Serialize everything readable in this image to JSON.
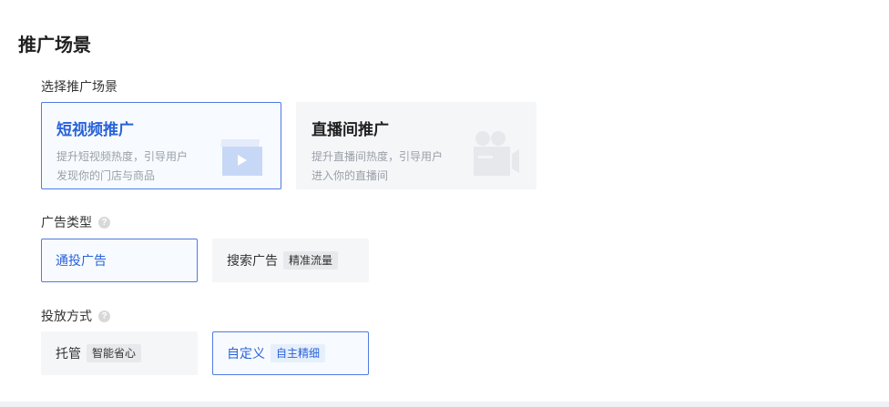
{
  "section": {
    "title": "推广场景"
  },
  "scene": {
    "label": "选择推广场景",
    "options": [
      {
        "title": "短视频推广",
        "desc_line1": "提升短视频热度，引导用户",
        "desc_line2": "发现你的门店与商品",
        "icon": "video-play-icon",
        "selected": true
      },
      {
        "title": "直播间推广",
        "desc_line1": "提升直播间热度，引导用户",
        "desc_line2": "进入你的直播间",
        "icon": "camera-icon",
        "selected": false
      }
    ]
  },
  "ad_type": {
    "label": "广告类型",
    "options": [
      {
        "label": "通投广告",
        "tag": "",
        "selected": true
      },
      {
        "label": "搜索广告",
        "tag": "精准流量",
        "selected": false
      }
    ]
  },
  "delivery": {
    "label": "投放方式",
    "options": [
      {
        "label": "托管",
        "tag": "智能省心",
        "selected": false
      },
      {
        "label": "自定义",
        "tag": "自主精细",
        "selected": true
      }
    ]
  },
  "colors": {
    "accent": "#2b63d8",
    "border_selected": "#4f7be0",
    "card_bg": "#f5f6f8"
  }
}
